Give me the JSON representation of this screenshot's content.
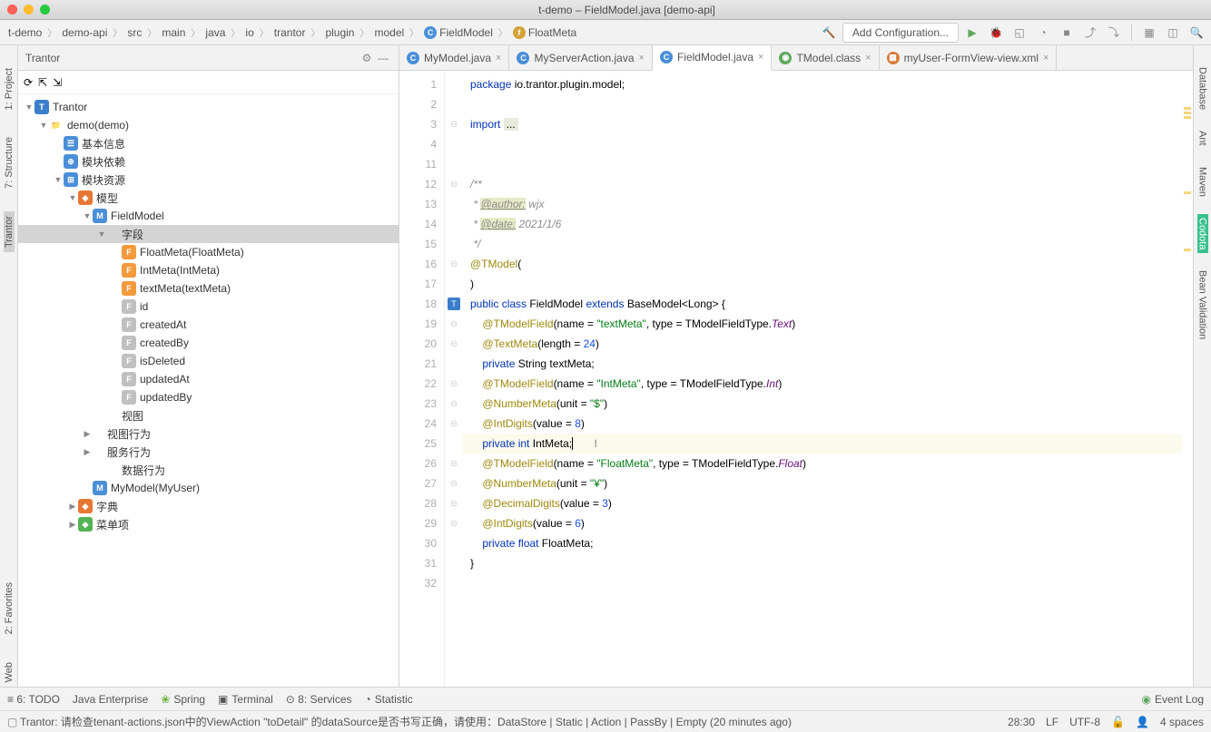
{
  "window": {
    "title": "t-demo – FieldModel.java [demo-api]"
  },
  "breadcrumb": [
    "t-demo",
    "demo-api",
    "src",
    "main",
    "java",
    "io",
    "trantor",
    "plugin",
    "model",
    "FieldModel",
    "FloatMeta"
  ],
  "run_config": "Add Configuration...",
  "sidepanel": {
    "title": "Trantor"
  },
  "tree": [
    {
      "d": 0,
      "a": "▼",
      "ic": "T",
      "icbg": "#3b7ecb",
      "t": "Trantor"
    },
    {
      "d": 1,
      "a": "▼",
      "ic": "📁",
      "icbg": "#888",
      "t": "demo(demo)",
      "folder": true
    },
    {
      "d": 2,
      "a": "",
      "ic": "☰",
      "icbg": "#4a8fd8",
      "t": "基本信息"
    },
    {
      "d": 2,
      "a": "",
      "ic": "⊕",
      "icbg": "#4a8fd8",
      "t": "模块依赖"
    },
    {
      "d": 2,
      "a": "▼",
      "ic": "⊞",
      "icbg": "#4a8fd8",
      "t": "模块资源"
    },
    {
      "d": 3,
      "a": "▼",
      "ic": "◈",
      "icbg": "#e67732",
      "t": "模型"
    },
    {
      "d": 4,
      "a": "▼",
      "ic": "M",
      "icbg": "#4a8fd8",
      "t": "FieldModel"
    },
    {
      "d": 5,
      "a": "▼",
      "ic": "",
      "icbg": "",
      "t": "字段",
      "sel": true
    },
    {
      "d": 6,
      "a": "",
      "ic": "F",
      "icbg": "#f39a3c",
      "t": "FloatMeta(FloatMeta)"
    },
    {
      "d": 6,
      "a": "",
      "ic": "F",
      "icbg": "#f39a3c",
      "t": "IntMeta(IntMeta)"
    },
    {
      "d": 6,
      "a": "",
      "ic": "F",
      "icbg": "#f39a3c",
      "t": "textMeta(textMeta)"
    },
    {
      "d": 6,
      "a": "",
      "ic": "F",
      "icbg": "#c0c0c0",
      "t": "id"
    },
    {
      "d": 6,
      "a": "",
      "ic": "F",
      "icbg": "#c0c0c0",
      "t": "createdAt"
    },
    {
      "d": 6,
      "a": "",
      "ic": "F",
      "icbg": "#c0c0c0",
      "t": "createdBy"
    },
    {
      "d": 6,
      "a": "",
      "ic": "F",
      "icbg": "#c0c0c0",
      "t": "isDeleted"
    },
    {
      "d": 6,
      "a": "",
      "ic": "F",
      "icbg": "#c0c0c0",
      "t": "updatedAt"
    },
    {
      "d": 6,
      "a": "",
      "ic": "F",
      "icbg": "#c0c0c0",
      "t": "updatedBy"
    },
    {
      "d": 5,
      "a": "",
      "ic": "",
      "icbg": "",
      "t": "视图"
    },
    {
      "d": 4,
      "a": "▶",
      "ic": "",
      "icbg": "",
      "t": "视图行为"
    },
    {
      "d": 4,
      "a": "▶",
      "ic": "",
      "icbg": "",
      "t": "服务行为"
    },
    {
      "d": 5,
      "a": "",
      "ic": "",
      "icbg": "",
      "t": "数据行为"
    },
    {
      "d": 4,
      "a": "",
      "ic": "M",
      "icbg": "#4a8fd8",
      "t": "MyModel(MyUser)"
    },
    {
      "d": 3,
      "a": "▶",
      "ic": "◈",
      "icbg": "#e67732",
      "t": "字典"
    },
    {
      "d": 3,
      "a": "▶",
      "ic": "◈",
      "icbg": "#53b353",
      "t": "菜单项"
    }
  ],
  "tabs": [
    {
      "ic": "C",
      "bg": "#4a8fd8",
      "t": "MyModel.java"
    },
    {
      "ic": "C",
      "bg": "#4a8fd8",
      "t": "MyServerAction.java"
    },
    {
      "ic": "C",
      "bg": "#4a8fd8",
      "t": "FieldModel.java",
      "active": true
    },
    {
      "ic": "◉",
      "bg": "#5fa85f",
      "t": "TModel.class"
    },
    {
      "ic": "▦",
      "bg": "#d97a3a",
      "t": "myUser-FormView-view.xml"
    }
  ],
  "left_rail": [
    "1: Project",
    "7: Structure",
    "Trantor",
    "2: Favorites",
    "Web"
  ],
  "right_rail": [
    "Database",
    "Ant",
    "Maven",
    "Codota",
    "Bean Validation"
  ],
  "bottom": [
    "≡ 6: TODO",
    "Java Enterprise",
    "Spring",
    "Terminal",
    "⊙ 8: Services",
    "Statistic"
  ],
  "event_log": "Event Log",
  "status": {
    "left": "Trantor: 请检查tenant-actions.json中的ViewAction \"toDetail\" 的dataSource是否书写正确，请使用：DataStore | Static | Action | PassBy | Empty (20 minutes ago)",
    "pos": "28:30",
    "le": "LF",
    "enc": "UTF-8",
    "indent": "4 spaces"
  },
  "code_lines": [
    "1",
    "2",
    "3",
    "4",
    "11",
    "12",
    "13",
    "14",
    "15",
    "16",
    "17",
    "18",
    "19",
    "20",
    "21",
    "22",
    "23",
    "24",
    "25",
    "26",
    "27",
    "28",
    "29",
    "30",
    "31",
    "32"
  ]
}
